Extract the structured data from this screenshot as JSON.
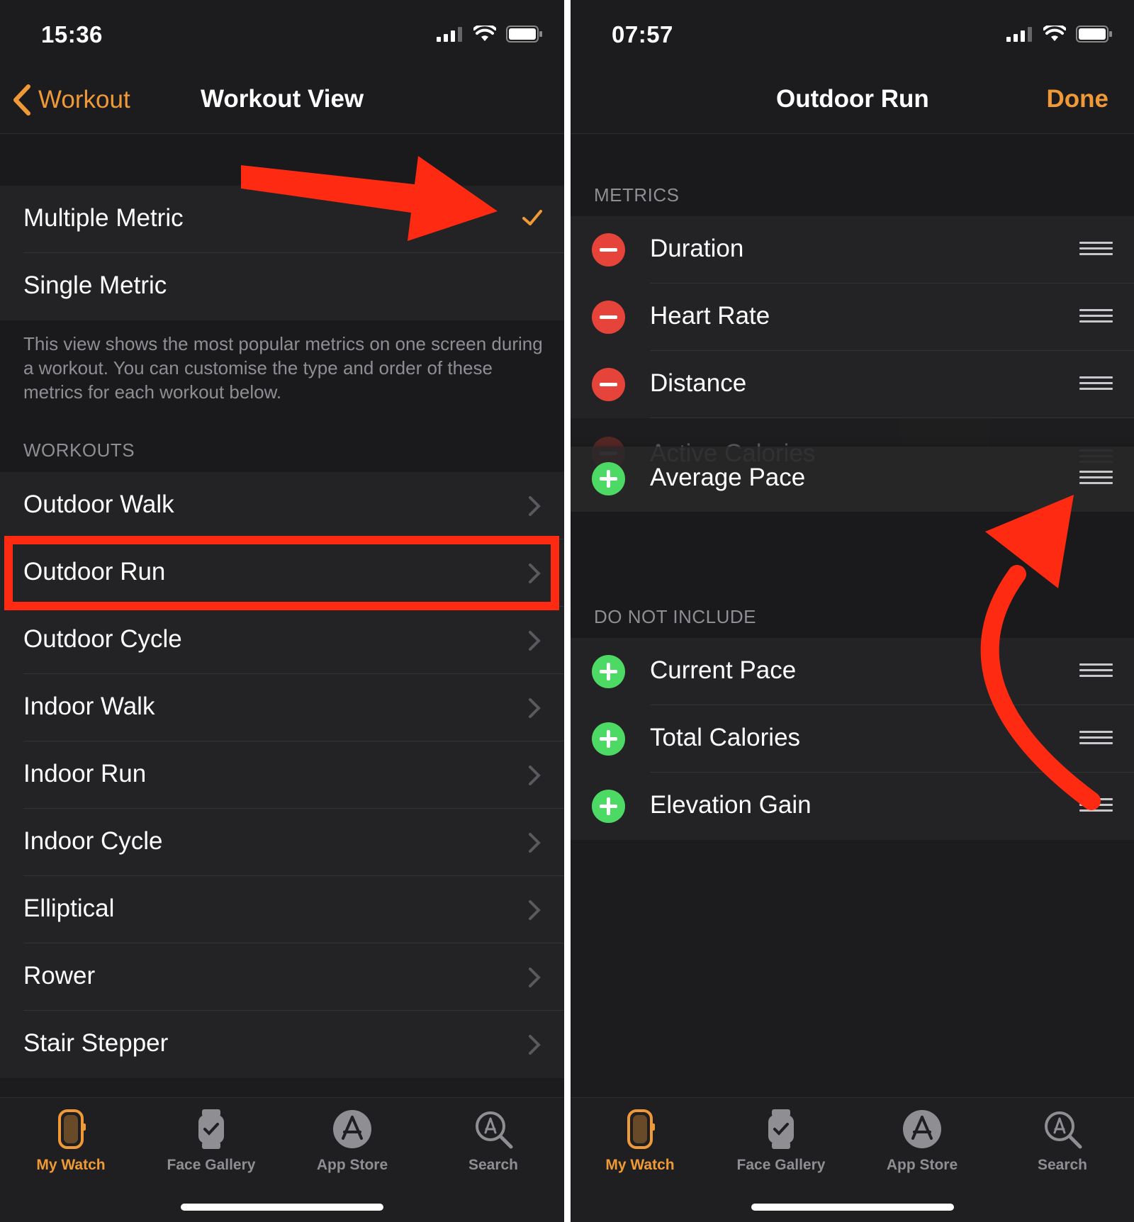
{
  "left": {
    "status_time": "15:36",
    "nav_back": "Workout",
    "nav_title": "Workout View",
    "view_options": [
      {
        "label": "Multiple Metric",
        "selected": true
      },
      {
        "label": "Single Metric",
        "selected": false
      }
    ],
    "footnote": "This view shows the most popular metrics on one screen during a workout. You can customise the type and order of these metrics for each workout below.",
    "workouts_header": "WORKOUTS",
    "workouts": [
      "Outdoor Walk",
      "Outdoor Run",
      "Outdoor Cycle",
      "Indoor Walk",
      "Indoor Run",
      "Indoor Cycle",
      "Elliptical",
      "Rower",
      "Stair Stepper"
    ],
    "highlighted_workout": "Outdoor Run"
  },
  "right": {
    "status_time": "07:57",
    "nav_title": "Outdoor Run",
    "nav_done": "Done",
    "metrics_header": "METRICS",
    "metrics": [
      "Duration",
      "Heart Rate",
      "Distance"
    ],
    "dragging_under": "Active Calories",
    "dragging_item": "Average Pace",
    "exclude_header": "DO NOT INCLUDE",
    "excluded": [
      "Current Pace",
      "Total Calories",
      "Elevation Gain"
    ]
  },
  "tabbar": {
    "tabs": [
      {
        "label": "My Watch",
        "icon": "watch-icon",
        "active": true
      },
      {
        "label": "Face Gallery",
        "icon": "face-gallery-icon",
        "active": false
      },
      {
        "label": "App Store",
        "icon": "app-store-icon",
        "active": false
      },
      {
        "label": "Search",
        "icon": "search-icon",
        "active": false
      }
    ]
  },
  "colors": {
    "accent": "#f09a37",
    "background": "#1c1c1e",
    "row": "#232325",
    "annotation_red": "#ff2a12",
    "minus": "#e6443a",
    "plus": "#4cd964"
  }
}
